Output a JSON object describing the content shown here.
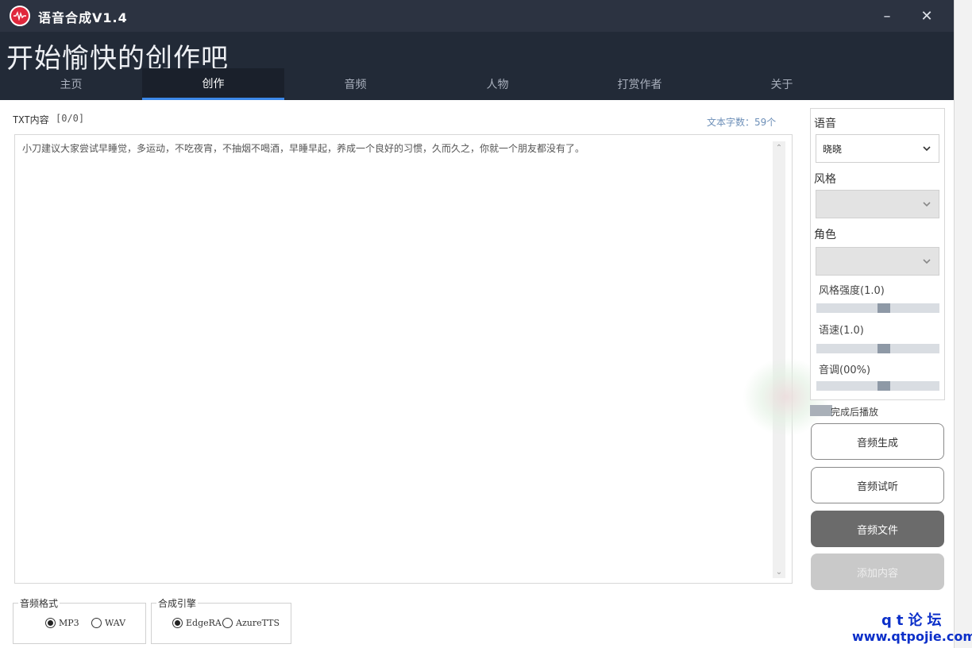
{
  "window": {
    "title": "语音合成V1.4"
  },
  "header": {
    "slogan": "开始愉快的创作吧",
    "tabs": [
      {
        "label": "主页"
      },
      {
        "label": "创作"
      },
      {
        "label": "音频"
      },
      {
        "label": "人物"
      },
      {
        "label": "打赏作者"
      },
      {
        "label": "关于"
      }
    ],
    "active_tab": "创作"
  },
  "editor": {
    "label": "TXT内容",
    "counter": "[0/0]",
    "char_count": "文本字数：59个",
    "text": "小刀建议大家尝试早睡觉，多运动，不吃夜宵，不抽烟不喝酒，早睡早起，养成一个良好的习惯，久而久之，你就一个朋友都没有了。"
  },
  "settings": {
    "voice_label": "语音",
    "voice_value": "晓晓",
    "style_label": "风格",
    "style_value": "",
    "role_label": "角色",
    "role_value": "",
    "style_strength_label": "风格强度(1.0)",
    "style_strength_value": 0.55,
    "speed_label": "语速(1.0)",
    "speed_value": 0.55,
    "pitch_label": "音调(00%)",
    "pitch_value": 0.55
  },
  "autoplay": {
    "label": "完成后播放"
  },
  "actions": {
    "generate": "音频生成",
    "preview": "音频试听",
    "file": "音频文件",
    "add": "添加内容"
  },
  "format_group": {
    "title": "音频格式",
    "options": [
      {
        "label": "MP3",
        "checked": true
      },
      {
        "label": "WAV",
        "checked": false
      }
    ]
  },
  "engine_group": {
    "title": "合成引擎",
    "options": [
      {
        "label": "EdgeRA",
        "checked": true
      },
      {
        "label": "AzureTTS",
        "checked": false
      }
    ]
  },
  "watermark": {
    "line1": "qt论坛",
    "line2": "www.qtpojie.com"
  },
  "colors": {
    "titlebar": "#2c3341",
    "header": "#222a37",
    "tab_accent": "#3c88e8",
    "logo": "#e0283c"
  }
}
